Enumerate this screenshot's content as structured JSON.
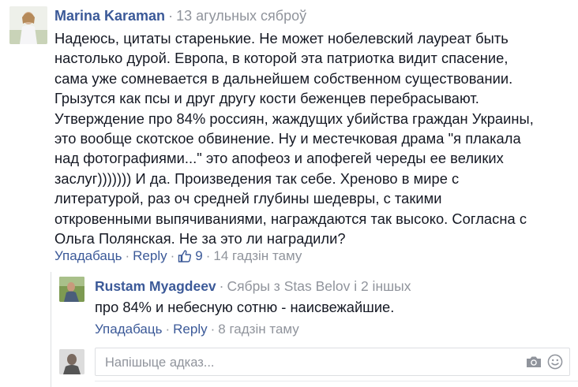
{
  "comment": {
    "author": "Marina Karaman",
    "time": "13 агульных сяброў",
    "lines": [
      "Надеюсь, цитаты старенькие. Не может нобелевский лауреат быть",
      "настолько дурой. Европа, в которой эта патриотка видит спасение,",
      "сама уже сомневается в дальнейшем собственном существовании.",
      "Грызутся как псы и друг другу кости беженцев перебрасывают.",
      "Утверждение про 84% россиян, жаждущих убийства граждан Украины,",
      "это вообще скотское обвинение. Ну и местечковая драма \"я плакала",
      "над фотографиями...\" это апофеоз и апофегей череды ее великих",
      "заслуг))))))) И да. Произведения так себе. Хреново в мире с",
      "литературой, раз оч средней глубины шедевры, с такими",
      "откровенными выпячиваниями, награждаются так высоко. Согласна с",
      "Ольга Полянская. Не за это ли наградили?"
    ],
    "actions": {
      "like": "Упадабаць",
      "reply": "Reply",
      "like_count": "9",
      "time": "14 гадзін таму"
    }
  },
  "reply": {
    "author": "Rustam Myagdeev",
    "context": "Сябры з Stas Belov і 2 іншых",
    "text": "про 84% и небесную сотню - наисвежайшие.",
    "actions": {
      "like": "Упадабаць",
      "reply": "Reply",
      "time": "8 гадзін таму"
    }
  },
  "reply_form": {
    "placeholder": "Напішыце адказ...",
    "icons": [
      "camera-icon",
      "smile-icon"
    ]
  },
  "colors": {
    "link": "#3b5998",
    "muted": "#90949c",
    "text": "#141823",
    "border": "#dddfe2"
  }
}
